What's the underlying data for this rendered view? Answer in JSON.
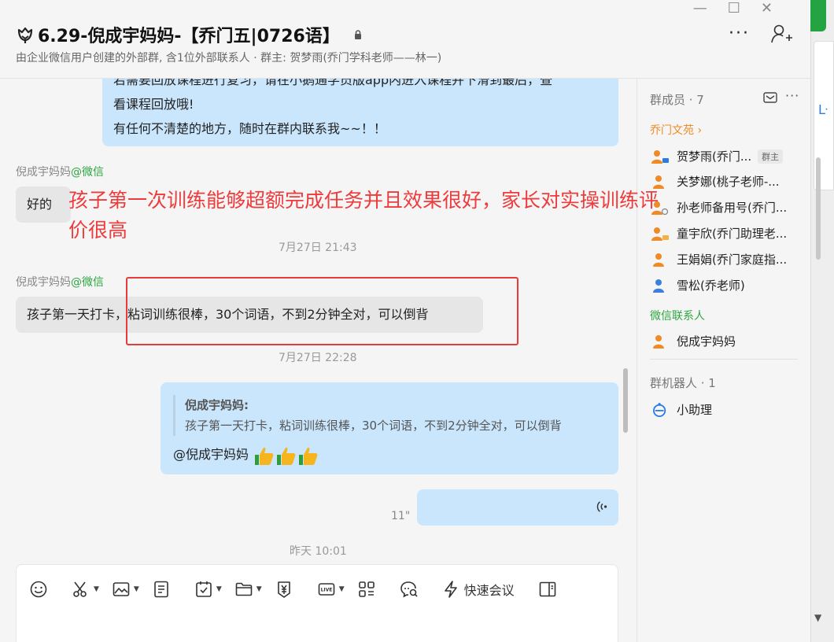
{
  "header": {
    "title": "6.29-倪成宇妈妈-【乔门五|0726语】",
    "subtitle": "由企业微信用户创建的外部群, 含1位外部联系人 · 群主: 贺梦雨(乔门学科老师——林一)",
    "more_label": "···"
  },
  "chat": {
    "msg1_lines": [
      "若需要回放课程进行复习，请在小鹅通学员版app内进入课程并下滑到最后，查",
      "看课程回放哦!",
      "有任何不清楚的地方，随时在群内联系我~~！！"
    ],
    "msg2": {
      "sender": "倪成宇妈妈",
      "sender_tag": "@微信",
      "text": "好的"
    },
    "annotation": "孩子第一次训练能够超额完成任务并且效果很好，家长对实操训练评价很高",
    "time1": "7月27日 21:43",
    "msg3": {
      "sender": "倪成宇妈妈",
      "sender_tag": "@微信",
      "text": "孩子第一天打卡，粘词训练很棒，30个词语，不到2分钟全对，可以倒背"
    },
    "time2": "7月27日 22:28",
    "msg4": {
      "quote_sender": "倪成宇妈妈:",
      "quote_text": "孩子第一天打卡，粘词训练很棒，30个词语，不到2分钟全对，可以倒背",
      "mention": "@倪成宇妈妈"
    },
    "voice": {
      "duration": "11\""
    },
    "time3": "昨天 10:01"
  },
  "composer": {
    "quick_meeting_label": "快速会议"
  },
  "panel": {
    "members_header": "群成员 · 7",
    "more_label": "···",
    "section_company": "乔门文苑",
    "members": [
      {
        "name": "贺梦雨(乔门...",
        "badge": "群主",
        "color": "#f08a24"
      },
      {
        "name": "关梦娜(桃子老师-...",
        "color": "#f08a24"
      },
      {
        "name": "孙老师备用号(乔门...",
        "color": "#f08a24"
      },
      {
        "name": "童宇欣(乔门助理老...",
        "color": "#f08a24"
      },
      {
        "name": "王娟娟(乔门家庭指...",
        "color": "#f08a24"
      },
      {
        "name": "雪松(乔老师)",
        "color": "#3a7fe0"
      }
    ],
    "section_wechat": "微信联系人",
    "wechat_member": "倪成宇妈妈",
    "robots_header": "群机器人 · 1",
    "robot_name": "小助理"
  }
}
